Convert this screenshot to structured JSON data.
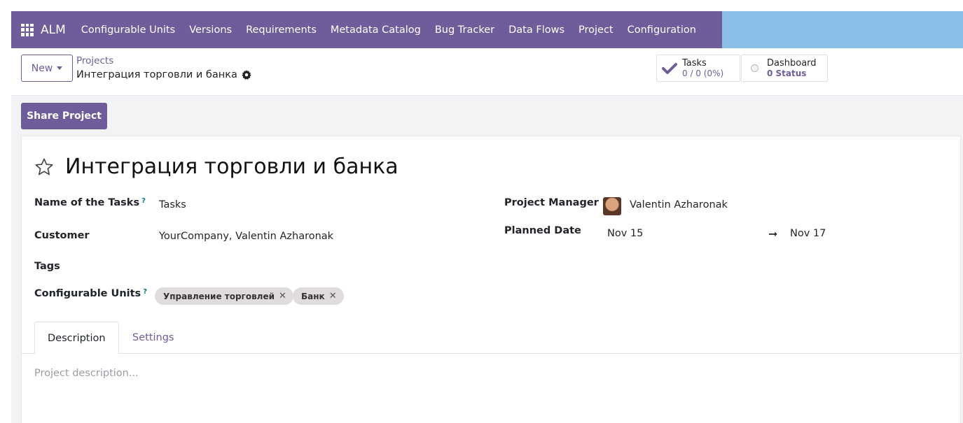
{
  "navbar": {
    "brand": "ALM",
    "menu": [
      "Configurable Units",
      "Versions",
      "Requirements",
      "Metadata Catalog",
      "Bug Tracker",
      "Data Flows",
      "Project",
      "Configuration"
    ],
    "colors": {
      "primary": "#6f5c9b",
      "accent_bar": "#8cbfe8"
    }
  },
  "control": {
    "new_label": "New",
    "breadcrumb_parent": "Projects",
    "breadcrumb_current": "Интеграция торговли и банка",
    "stats": {
      "tasks_label": "Tasks",
      "tasks_value": "0 / 0 (0%)",
      "dashboard_label": "Dashboard",
      "dashboard_value": "0 Status"
    }
  },
  "actions": {
    "share_label": "Share Project"
  },
  "form": {
    "title": "Интеграция торговли и банка",
    "name_of_tasks_label": "Name of the Tasks",
    "name_of_tasks_value": "Tasks",
    "customer_label": "Customer",
    "customer_value": "YourCompany, Valentin Azharonak",
    "tags_label": "Tags",
    "configurable_units_label": "Configurable Units",
    "configurable_units": [
      "Управление торговлей",
      "Банк"
    ],
    "project_manager_label": "Project Manager",
    "project_manager_value": "Valentin Azharonak",
    "planned_date_label": "Planned Date",
    "planned_start": "Nov 15",
    "planned_end": "Nov 17",
    "help_mark": "?"
  },
  "tabs": {
    "description": "Description",
    "settings": "Settings"
  },
  "description_placeholder": "Project description..."
}
